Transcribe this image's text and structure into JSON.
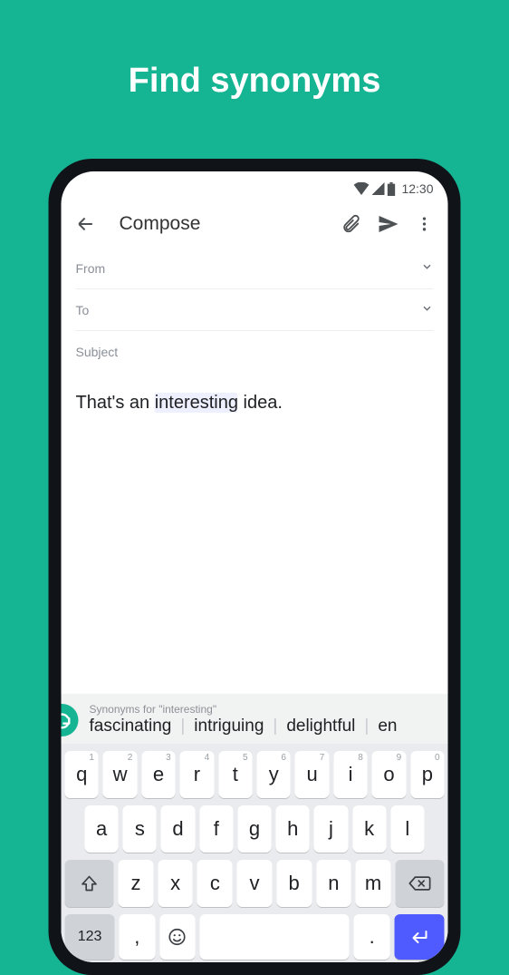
{
  "promo": {
    "title": "Find synonyms"
  },
  "status": {
    "time": "12:30"
  },
  "topbar": {
    "title": "Compose"
  },
  "fields": {
    "from": "From",
    "to": "To",
    "subject": "Subject"
  },
  "body": {
    "pre": "That's an ",
    "highlight": "interesting",
    "post": " idea."
  },
  "suggestion": {
    "heading": "Synonyms for \"interesting\"",
    "items": [
      "fascinating",
      "intriguing",
      "delightful",
      "en"
    ]
  },
  "keyboard": {
    "r1": [
      {
        "l": "q",
        "s": "1"
      },
      {
        "l": "w",
        "s": "2"
      },
      {
        "l": "e",
        "s": "3"
      },
      {
        "l": "r",
        "s": "4"
      },
      {
        "l": "t",
        "s": "5"
      },
      {
        "l": "y",
        "s": "6"
      },
      {
        "l": "u",
        "s": "7"
      },
      {
        "l": "i",
        "s": "8"
      },
      {
        "l": "o",
        "s": "9"
      },
      {
        "l": "p",
        "s": "0"
      }
    ],
    "r2": [
      "a",
      "s",
      "d",
      "f",
      "g",
      "h",
      "j",
      "k",
      "l"
    ],
    "r3": [
      "z",
      "x",
      "c",
      "v",
      "b",
      "n",
      "m"
    ],
    "numKey": "123",
    "comma": ",",
    "period": "."
  }
}
